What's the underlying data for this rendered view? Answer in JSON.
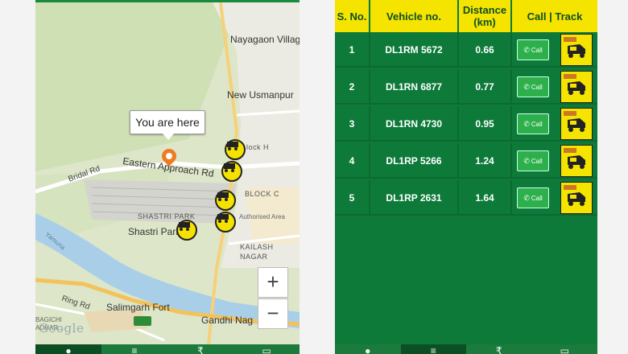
{
  "map": {
    "labels": {
      "nayagaon": "Nayagaon Villag",
      "new_usmanpur": "New Usmanpur",
      "block_h": "lock H",
      "eastern_approach": "Eastern Approach Rd",
      "bridal_rd": "Bridal Rd",
      "block_c": "BLOCK C",
      "shastri_park_area": "SHASTRI PARK",
      "shastri_park": "Shastri Park",
      "authorised_area": "Authorised Area",
      "kailash_nagar": "KAILASH\nNAGAR",
      "ring_rd": "Ring Rd",
      "salimgarh": "Salimgarh Fort",
      "gandhi_nagar": "Gandhi Nag",
      "bagichi": "BAGICHI\nADHAR...",
      "yamuna": "Yamuna",
      "ah2": "AH 2"
    },
    "tooltip": "You are here",
    "google": "Google",
    "zoom_in": "+",
    "zoom_out": "−",
    "accent": "#f07a20"
  },
  "nav": {
    "items": [
      {
        "icon": "location-pin-icon",
        "glyph": "●"
      },
      {
        "icon": "menu-icon",
        "glyph": "≡"
      },
      {
        "icon": "rupee-icon",
        "glyph": "₹"
      },
      {
        "icon": "card-icon",
        "glyph": "▭"
      }
    ]
  },
  "table": {
    "headers": {
      "sno": "S. No.",
      "vehicle": "Vehicle no.",
      "distance": "Distance\n(km)",
      "actions": "Call | Track"
    },
    "rows": [
      {
        "sno": "1",
        "vehicle": "DL1RM 5672",
        "distance": "0.66",
        "call": "Call"
      },
      {
        "sno": "2",
        "vehicle": "DL1RN 6877",
        "distance": "0.77",
        "call": "Call"
      },
      {
        "sno": "3",
        "vehicle": "DL1RN 4730",
        "distance": "0.95",
        "call": "Call"
      },
      {
        "sno": "4",
        "vehicle": "DL1RP 5266",
        "distance": "1.24",
        "call": "Call"
      },
      {
        "sno": "5",
        "vehicle": "DL1RP 2631",
        "distance": "1.64",
        "call": "Call"
      }
    ],
    "header_color": "#f5e300",
    "body_color": "#0d7a3a"
  }
}
